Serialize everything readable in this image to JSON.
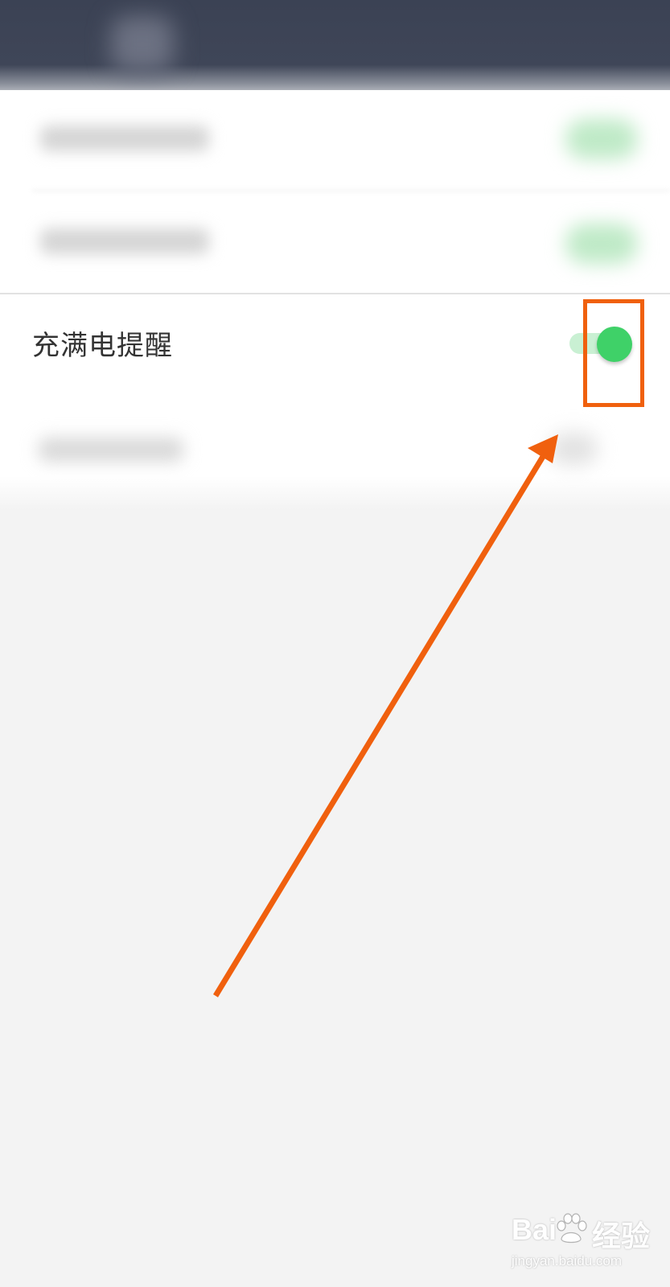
{
  "settings": {
    "charge_full_reminder": {
      "label": "充满电提醒",
      "enabled": true
    }
  },
  "colors": {
    "toggle_on_knob": "#3fd168",
    "toggle_on_track": "#c9f0d3",
    "annotation": "#f0600e",
    "header_bg": "#3b4254"
  },
  "watermark": {
    "brand_left": "Bai",
    "brand_right": "经验",
    "url": "jingyan.baidu.com",
    "icon": "paw-icon"
  }
}
